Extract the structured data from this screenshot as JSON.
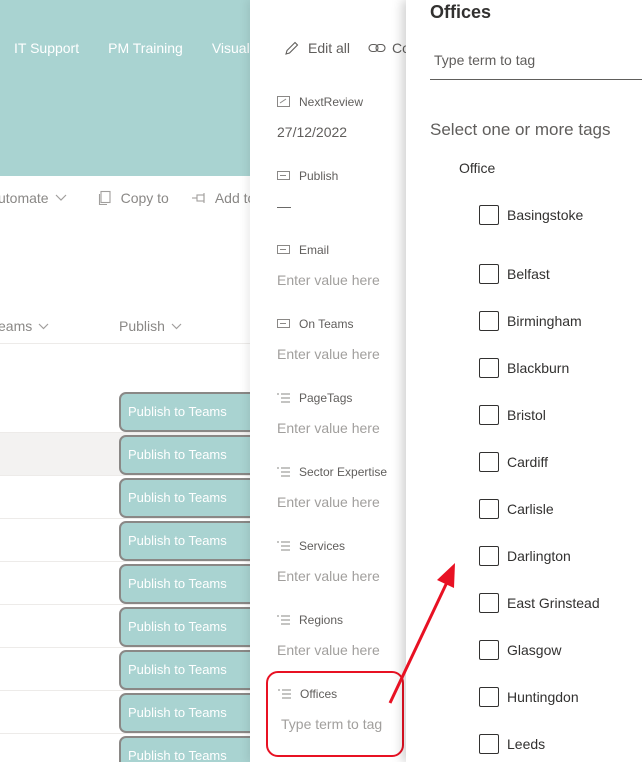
{
  "topnav": {
    "items": [
      "IT Support",
      "PM Training",
      "Visualis"
    ]
  },
  "commandbar": {
    "automate": "utomate",
    "copy_to": "Copy to",
    "add_to": "Add to"
  },
  "list": {
    "columns": {
      "teams": "eams",
      "publish": "Publish"
    },
    "publish_button_label": "Publish to Teams"
  },
  "properties": {
    "edit_all": "Edit all",
    "copy_link": "Co",
    "fields": [
      {
        "label": "NextReview",
        "value": "27/12/2022",
        "icon": "calendar-edit-icon"
      },
      {
        "label": "Publish",
        "value": "—",
        "icon": "text-field-icon"
      },
      {
        "label": "Email",
        "value": "Enter value here",
        "icon": "text-field-icon"
      },
      {
        "label": "On Teams",
        "value": "Enter value here",
        "icon": "text-field-icon"
      },
      {
        "label": "PageTags",
        "value": "Enter value here",
        "icon": "choice-list-icon"
      },
      {
        "label": "Sector Expertise",
        "value": "Enter value here",
        "icon": "choice-list-icon"
      },
      {
        "label": "Services",
        "value": "Enter value here",
        "icon": "choice-list-icon"
      },
      {
        "label": "Regions",
        "value": "Enter value here",
        "icon": "choice-list-icon"
      },
      {
        "label": "Offices",
        "value": "Type term to tag",
        "icon": "choice-list-icon"
      }
    ]
  },
  "picker": {
    "title": "Offices",
    "placeholder": "Type term to tag",
    "subtitle": "Select one or more tags",
    "group": "Office",
    "tags": [
      "Basingstoke",
      "Belfast",
      "Birmingham",
      "Blackburn",
      "Bristol",
      "Cardiff",
      "Carlisle",
      "Darlington",
      "East Grinstead",
      "Glasgow",
      "Huntingdon",
      "Leeds"
    ]
  },
  "colors": {
    "accent": "#a9d3d1",
    "annotation": "#e81123"
  }
}
